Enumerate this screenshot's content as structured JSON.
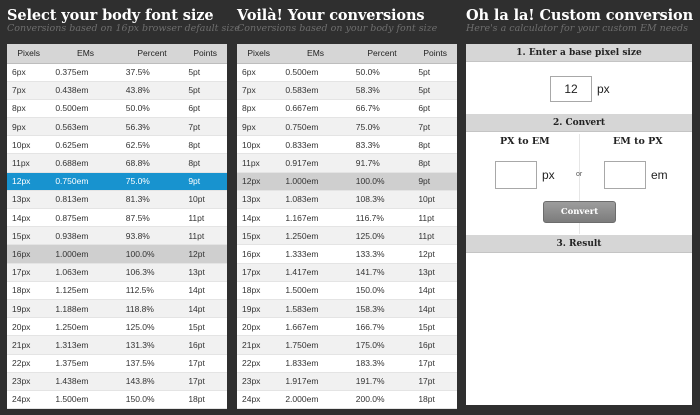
{
  "left": {
    "title": "Select your body font size",
    "subtitle": "Conversions based on 16px browser default size",
    "headers": [
      "Pixels",
      "EMs",
      "Percent",
      "Points"
    ],
    "rows": [
      [
        "6px",
        "0.375em",
        "37.5%",
        "5pt"
      ],
      [
        "7px",
        "0.438em",
        "43.8%",
        "5pt"
      ],
      [
        "8px",
        "0.500em",
        "50.0%",
        "6pt"
      ],
      [
        "9px",
        "0.563em",
        "56.3%",
        "7pt"
      ],
      [
        "10px",
        "0.625em",
        "62.5%",
        "8pt"
      ],
      [
        "11px",
        "0.688em",
        "68.8%",
        "8pt"
      ],
      [
        "12px",
        "0.750em",
        "75.0%",
        "9pt"
      ],
      [
        "13px",
        "0.813em",
        "81.3%",
        "10pt"
      ],
      [
        "14px",
        "0.875em",
        "87.5%",
        "11pt"
      ],
      [
        "15px",
        "0.938em",
        "93.8%",
        "11pt"
      ],
      [
        "16px",
        "1.000em",
        "100.0%",
        "12pt"
      ],
      [
        "17px",
        "1.063em",
        "106.3%",
        "13pt"
      ],
      [
        "18px",
        "1.125em",
        "112.5%",
        "14pt"
      ],
      [
        "19px",
        "1.188em",
        "118.8%",
        "14pt"
      ],
      [
        "20px",
        "1.250em",
        "125.0%",
        "15pt"
      ],
      [
        "21px",
        "1.313em",
        "131.3%",
        "16pt"
      ],
      [
        "22px",
        "1.375em",
        "137.5%",
        "17pt"
      ],
      [
        "23px",
        "1.438em",
        "143.8%",
        "17pt"
      ],
      [
        "24px",
        "1.500em",
        "150.0%",
        "18pt"
      ]
    ],
    "selected_index": 6,
    "base_index": 10
  },
  "middle": {
    "title": "Voilà! Your conversions",
    "subtitle": "Conversions based on your body font size",
    "headers": [
      "Pixels",
      "EMs",
      "Percent",
      "Points"
    ],
    "rows": [
      [
        "6px",
        "0.500em",
        "50.0%",
        "5pt"
      ],
      [
        "7px",
        "0.583em",
        "58.3%",
        "5pt"
      ],
      [
        "8px",
        "0.667em",
        "66.7%",
        "6pt"
      ],
      [
        "9px",
        "0.750em",
        "75.0%",
        "7pt"
      ],
      [
        "10px",
        "0.833em",
        "83.3%",
        "8pt"
      ],
      [
        "11px",
        "0.917em",
        "91.7%",
        "8pt"
      ],
      [
        "12px",
        "1.000em",
        "100.0%",
        "9pt"
      ],
      [
        "13px",
        "1.083em",
        "108.3%",
        "10pt"
      ],
      [
        "14px",
        "1.167em",
        "116.7%",
        "11pt"
      ],
      [
        "15px",
        "1.250em",
        "125.0%",
        "11pt"
      ],
      [
        "16px",
        "1.333em",
        "133.3%",
        "12pt"
      ],
      [
        "17px",
        "1.417em",
        "141.7%",
        "13pt"
      ],
      [
        "18px",
        "1.500em",
        "150.0%",
        "14pt"
      ],
      [
        "19px",
        "1.583em",
        "158.3%",
        "14pt"
      ],
      [
        "20px",
        "1.667em",
        "166.7%",
        "15pt"
      ],
      [
        "21px",
        "1.750em",
        "175.0%",
        "16pt"
      ],
      [
        "22px",
        "1.833em",
        "183.3%",
        "17pt"
      ],
      [
        "23px",
        "1.917em",
        "191.7%",
        "17pt"
      ],
      [
        "24px",
        "2.000em",
        "200.0%",
        "18pt"
      ]
    ],
    "base_index": 6
  },
  "right": {
    "title": "Oh la la! Custom conversion",
    "subtitle": "Here's a calculator for your custom EM needs",
    "step1": "1. Enter a base pixel size",
    "base_value": "12",
    "base_unit": "px",
    "step2": "2. Convert",
    "px_to_em": "PX to EM",
    "em_to_px": "EM to PX",
    "px_unit": "px",
    "or": "or",
    "em_unit": "em",
    "px_value": "",
    "em_value": "",
    "convert_label": "Convert",
    "step3": "3. Result"
  }
}
